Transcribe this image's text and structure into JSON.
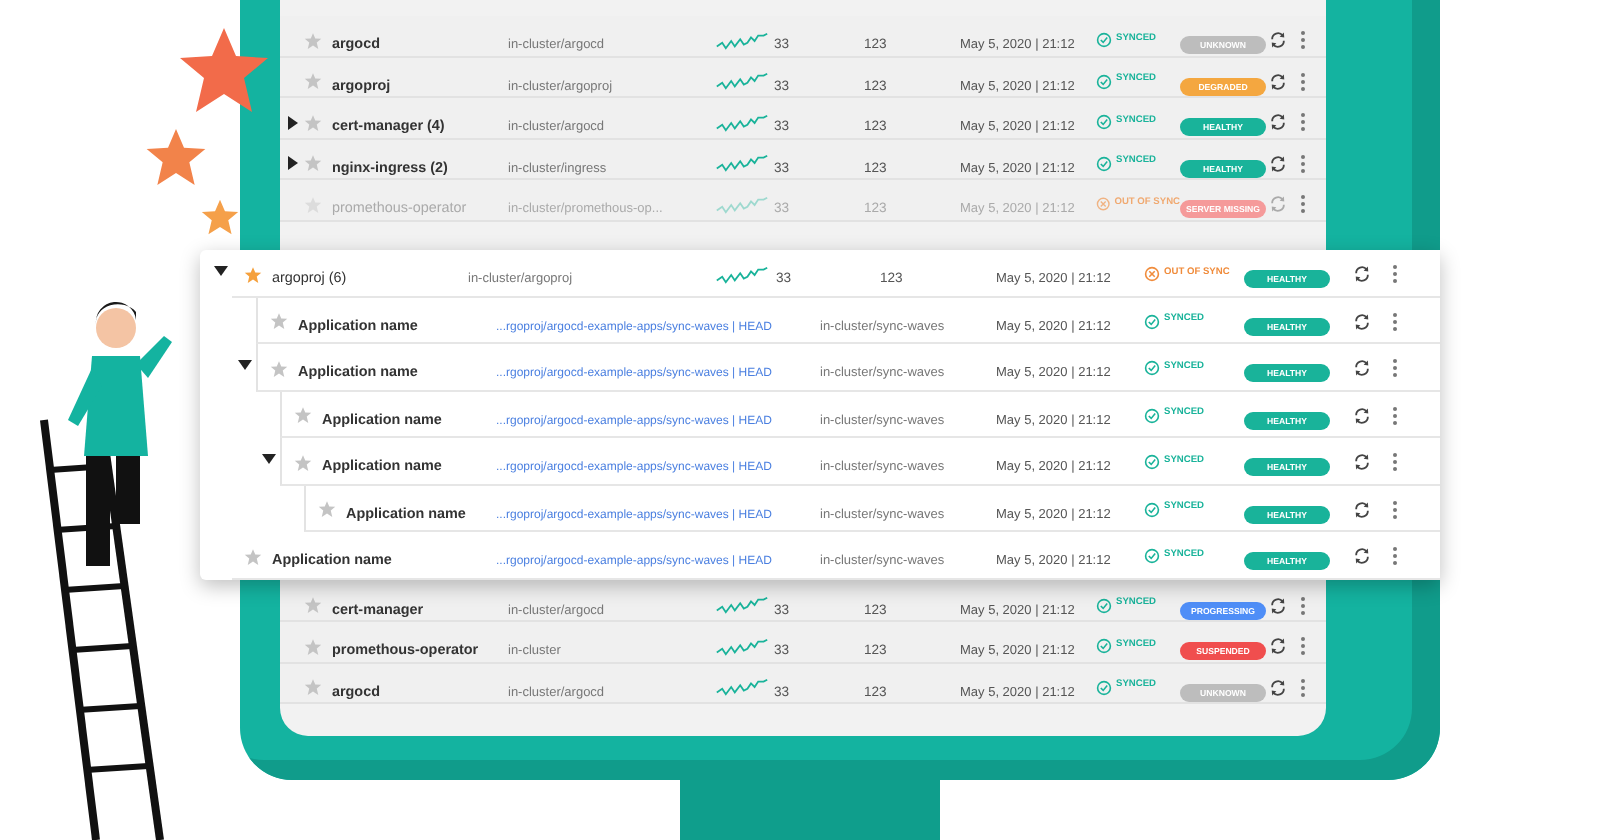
{
  "top_table": {
    "rows": [
      {
        "kind": "summary",
        "expandable": false,
        "starred": false,
        "faded": false,
        "name": "argocd",
        "cluster": "in-cluster/argocd",
        "number_1": "33",
        "number_2": "123",
        "date": "May 5, 2020 | 21:12",
        "sync": {
          "kind": "synced",
          "label": "SYNCED"
        },
        "health": {
          "label": "UNKNOWN",
          "color": "#bdbdbd"
        }
      },
      {
        "kind": "summary",
        "expandable": false,
        "starred": false,
        "faded": false,
        "name": "argoproj",
        "cluster": "in-cluster/argoproj",
        "number_1": "33",
        "number_2": "123",
        "date": "May 5, 2020 | 21:12",
        "sync": {
          "kind": "synced",
          "label": "SYNCED"
        },
        "health": {
          "label": "DEGRADED",
          "color": "#f4a740"
        }
      },
      {
        "kind": "summary",
        "expandable": true,
        "expanded": false,
        "starred": false,
        "faded": false,
        "name": "cert-manager (4)",
        "cluster": "in-cluster/argocd",
        "number_1": "33",
        "number_2": "123",
        "date": "May 5, 2020 | 21:12",
        "sync": {
          "kind": "synced",
          "label": "SYNCED"
        },
        "health": {
          "label": "HEALTHY",
          "color": "#19b39a"
        }
      },
      {
        "kind": "summary",
        "expandable": true,
        "expanded": false,
        "starred": false,
        "faded": false,
        "name": "nginx-ingress (2)",
        "cluster": "in-cluster/ingress",
        "number_1": "33",
        "number_2": "123",
        "date": "May 5, 2020 | 21:12",
        "sync": {
          "kind": "synced",
          "label": "SYNCED"
        },
        "health": {
          "label": "HEALTHY",
          "color": "#19b39a"
        }
      },
      {
        "kind": "summary",
        "expandable": false,
        "starred": false,
        "faded": true,
        "name": "promethous-operator",
        "cluster": "in-cluster/promethous-op...",
        "number_1": "33",
        "number_2": "123",
        "date": "May 5, 2020 | 21:12",
        "sync": {
          "kind": "out_of_sync",
          "label": "OUT OF SYNC"
        },
        "health": {
          "label": "SERVER MISSING",
          "color": "#f59a9a"
        }
      }
    ]
  },
  "popup": {
    "rows": [
      {
        "kind": "summary",
        "expandable": true,
        "expanded": true,
        "starred": true,
        "faded": false,
        "name": "argoproj (6)",
        "cluster": "in-cluster/argoproj",
        "number_1": "33",
        "number_2": "123",
        "date": "May 5, 2020 | 21:12",
        "sync": {
          "kind": "out_of_sync",
          "label": "OUT OF SYNC"
        },
        "health": {
          "label": "HEALTHY",
          "color": "#19b39a"
        },
        "children": [
          {
            "kind": "source",
            "expandable": false,
            "starred": false,
            "faded": false,
            "name": "Application name",
            "link": "...rgoproj/argocd-example-apps/sync-waves | HEAD",
            "cluster": "in-cluster/sync-waves",
            "date": "May 5, 2020 | 21:12",
            "sync": {
              "kind": "synced",
              "label": "SYNCED"
            },
            "health": {
              "label": "HEALTHY",
              "color": "#19b39a"
            }
          },
          {
            "kind": "source",
            "expandable": true,
            "expanded": true,
            "starred": false,
            "faded": false,
            "name": "Application name",
            "link": "...rgoproj/argocd-example-apps/sync-waves | HEAD",
            "cluster": "in-cluster/sync-waves",
            "date": "May 5, 2020 | 21:12",
            "sync": {
              "kind": "synced",
              "label": "SYNCED"
            },
            "health": {
              "label": "HEALTHY",
              "color": "#19b39a"
            },
            "children": [
              {
                "kind": "source",
                "expandable": false,
                "starred": false,
                "faded": false,
                "name": "Application name",
                "link": "...rgoproj/argocd-example-apps/sync-waves | HEAD",
                "cluster": "in-cluster/sync-waves",
                "date": "May 5, 2020 | 21:12",
                "sync": {
                  "kind": "synced",
                  "label": "SYNCED"
                },
                "health": {
                  "label": "HEALTHY",
                  "color": "#19b39a"
                }
              },
              {
                "kind": "source",
                "expandable": true,
                "expanded": true,
                "starred": false,
                "faded": false,
                "name": "Application name",
                "link": "...rgoproj/argocd-example-apps/sync-waves | HEAD",
                "cluster": "in-cluster/sync-waves",
                "date": "May 5, 2020 | 21:12",
                "sync": {
                  "kind": "synced",
                  "label": "SYNCED"
                },
                "health": {
                  "label": "HEALTHY",
                  "color": "#19b39a"
                },
                "children": [
                  {
                    "kind": "source",
                    "expandable": false,
                    "starred": false,
                    "faded": false,
                    "name": "Application name",
                    "link": "...rgoproj/argocd-example-apps/sync-waves | HEAD",
                    "cluster": "in-cluster/sync-waves",
                    "date": "May 5, 2020 | 21:12",
                    "sync": {
                      "kind": "synced",
                      "label": "SYNCED"
                    },
                    "health": {
                      "label": "HEALTHY",
                      "color": "#19b39a"
                    }
                  }
                ]
              }
            ]
          }
        ]
      },
      {
        "kind": "source",
        "expandable": false,
        "starred": false,
        "faded": false,
        "name": "Application name",
        "link": "...rgoproj/argocd-example-apps/sync-waves | HEAD",
        "cluster": "in-cluster/sync-waves",
        "date": "May 5, 2020 | 21:12",
        "sync": {
          "kind": "synced",
          "label": "SYNCED"
        },
        "health": {
          "label": "HEALTHY",
          "color": "#19b39a"
        }
      }
    ]
  },
  "bottom_table": {
    "rows": [
      {
        "kind": "summary",
        "expandable": false,
        "starred": false,
        "faded": false,
        "name": "cert-manager",
        "cluster": "in-cluster/argocd",
        "number_1": "33",
        "number_2": "123",
        "date": "May 5, 2020 | 21:12",
        "sync": {
          "kind": "synced",
          "label": "SYNCED"
        },
        "health": {
          "label": "PROGRESSING",
          "color": "#4f8ef7"
        }
      },
      {
        "kind": "summary",
        "expandable": false,
        "starred": false,
        "faded": false,
        "name": "promethous-operator",
        "cluster": "in-cluster",
        "number_1": "33",
        "number_2": "123",
        "date": "May 5, 2020 | 21:12",
        "sync": {
          "kind": "synced",
          "label": "SYNCED"
        },
        "health": {
          "label": "SUSPENDED",
          "color": "#f04e4e"
        }
      },
      {
        "kind": "summary",
        "expandable": false,
        "starred": false,
        "faded": false,
        "name": "argocd",
        "cluster": "in-cluster/argocd",
        "number_1": "33",
        "number_2": "123",
        "date": "May 5, 2020 | 21:12",
        "sync": {
          "kind": "synced",
          "label": "SYNCED"
        },
        "health": {
          "label": "UNKNOWN",
          "color": "#bdbdbd"
        }
      }
    ]
  }
}
